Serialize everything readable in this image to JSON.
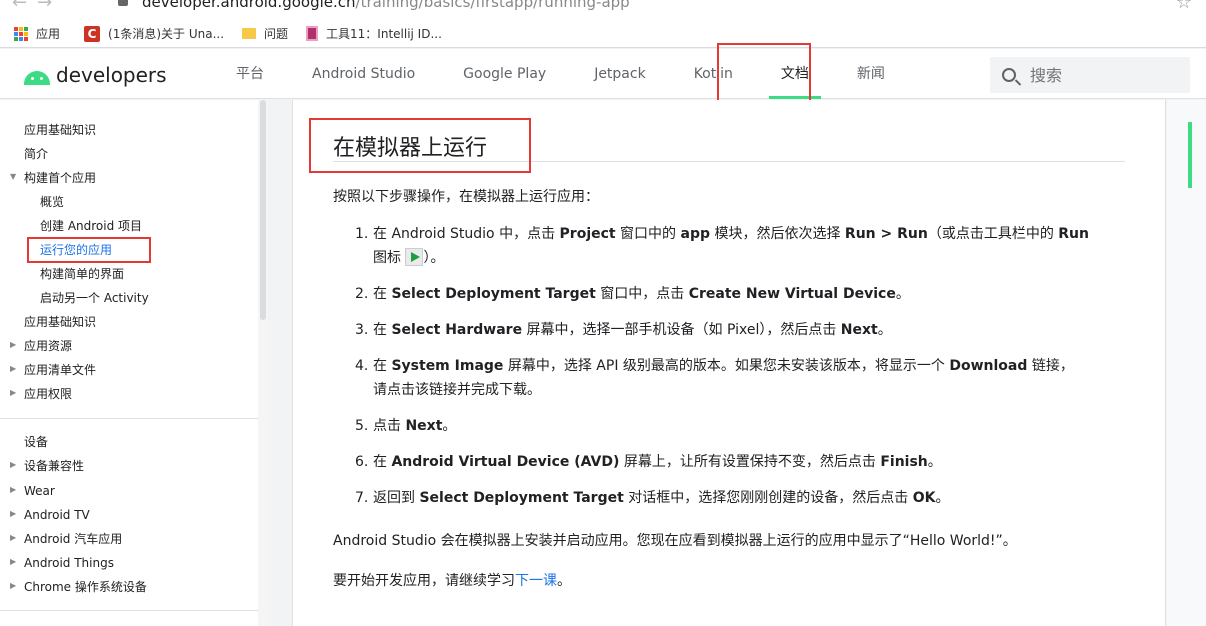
{
  "browser": {
    "url_host": "developer.android.google.cn",
    "url_path": "/training/basics/firstapp/running-app",
    "bookmarks": [
      {
        "label": "应用",
        "icon": "apps-grid-icon"
      },
      {
        "label": "(1条消息)关于 Una...",
        "icon": "csdn-icon"
      },
      {
        "label": "问题",
        "icon": "folder-icon"
      },
      {
        "label": "工具11：Intellij ID...",
        "icon": "book-icon"
      }
    ]
  },
  "header": {
    "logo_text": "developers",
    "nav": [
      "平台",
      "Android Studio",
      "Google Play",
      "Jetpack",
      "Kotlin",
      "文档",
      "新闻"
    ],
    "active_nav": "文档",
    "search_placeholder": "搜索"
  },
  "sidebar": {
    "group1": [
      {
        "label": "应用基础知识"
      },
      {
        "label": "简介"
      },
      {
        "label": "构建首个应用",
        "expanded": true
      },
      {
        "label": "概览",
        "sub": true
      },
      {
        "label": "创建 Android 项目",
        "sub": true
      },
      {
        "label": "运行您的应用",
        "sub": true,
        "active": true
      },
      {
        "label": "构建简单的界面",
        "sub": true
      },
      {
        "label": "启动另一个 Activity",
        "sub": true
      },
      {
        "label": "应用基础知识"
      },
      {
        "label": "应用资源",
        "collapsed": true
      },
      {
        "label": "应用清单文件",
        "collapsed": true
      },
      {
        "label": "应用权限",
        "collapsed": true
      }
    ],
    "group2": [
      {
        "label": "设备"
      },
      {
        "label": "设备兼容性",
        "collapsed": true
      },
      {
        "label": "Wear",
        "collapsed": true
      },
      {
        "label": "Android TV",
        "collapsed": true
      },
      {
        "label": "Android 汽车应用",
        "collapsed": true
      },
      {
        "label": "Android Things",
        "collapsed": true
      },
      {
        "label": "Chrome 操作系统设备",
        "collapsed": true
      }
    ]
  },
  "content": {
    "title": "在模拟器上运行",
    "intro": "按照以下步骤操作，在模拟器上运行应用：",
    "steps": {
      "s1": {
        "num": "1.",
        "a": "在 Android Studio 中，点击 ",
        "b1": "Project",
        "c": " 窗口中的 ",
        "b2": "app",
        "d": " 模块，然后依次选择 ",
        "b3": "Run > Run",
        "e": "（或点击工具栏中的 ",
        "b4": "Run",
        "f": "图标 ",
        "g": "）。"
      },
      "s2": {
        "num": "2.",
        "a": "在 ",
        "b1": "Select Deployment Target",
        "c": " 窗口中，点击 ",
        "b2": "Create New Virtual Device",
        "d": "。"
      },
      "s3": {
        "num": "3.",
        "a": "在 ",
        "b1": "Select Hardware",
        "c": " 屏幕中，选择一部手机设备（如 Pixel），然后点击 ",
        "b2": "Next",
        "d": "。"
      },
      "s4": {
        "num": "4.",
        "a": "在 ",
        "b1": "System Image",
        "c": " 屏幕中，选择 API 级别最高的版本。如果您未安装该版本，将显示一个 ",
        "b2": "Download",
        "d": " 链接，",
        "e": "请点击该链接并完成下载。"
      },
      "s5": {
        "num": "5.",
        "a": "点击 ",
        "b1": "Next",
        "c": "。"
      },
      "s6": {
        "num": "6.",
        "a": "在 ",
        "b1": "Android Virtual Device (AVD)",
        "c": " 屏幕上，让所有设置保持不变，然后点击 ",
        "b2": "Finish",
        "d": "。"
      },
      "s7": {
        "num": "7.",
        "a": "返回到 ",
        "b1": "Select Deployment Target",
        "c": " 对话框中，选择您刚刚创建的设备，然后点击 ",
        "b2": "OK",
        "d": "。"
      }
    },
    "outro": "Android Studio 会在模拟器上安装并启动应用。您现在应看到模拟器上运行的应用中显示了“Hello World!”。",
    "next_prefix": "要开始开发应用，请继续学习",
    "next_link": "下一课",
    "next_suffix": "。"
  }
}
